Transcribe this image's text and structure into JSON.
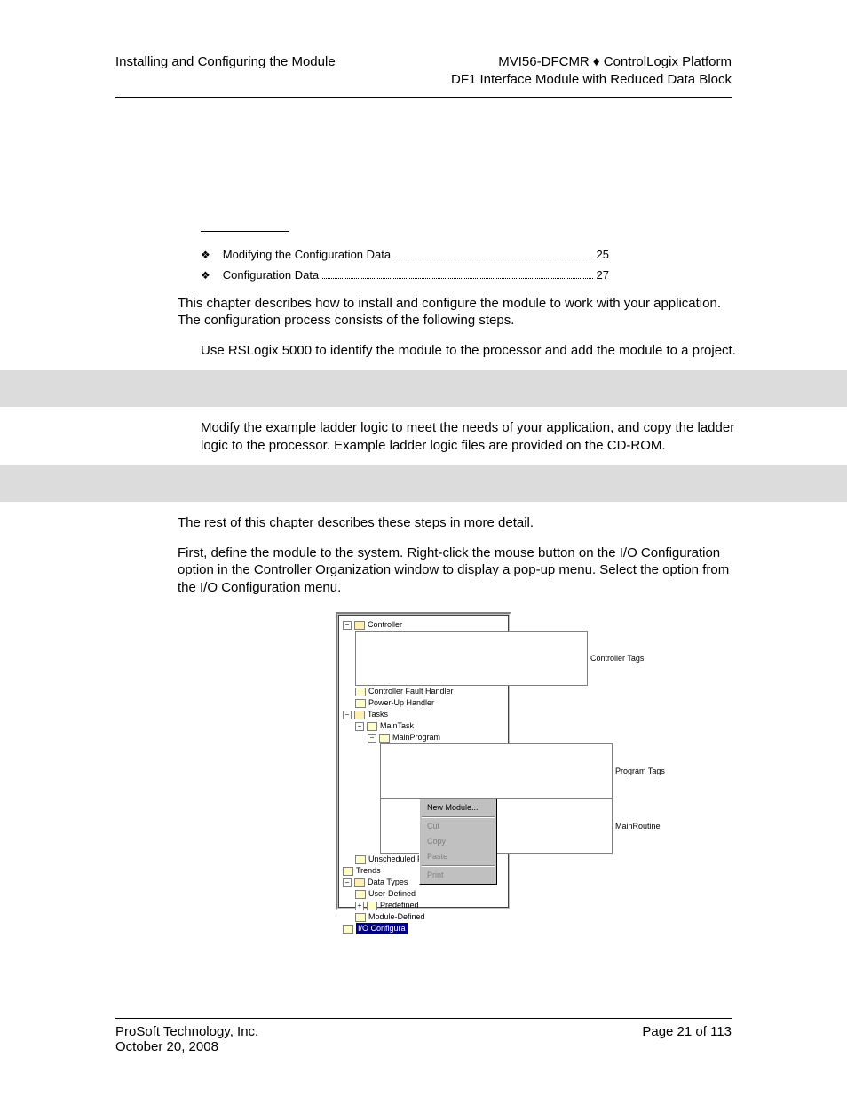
{
  "header": {
    "left": "Installing and Configuring the Module",
    "right_line1": "MVI56-DFCMR ♦ ControlLogix Platform",
    "right_line2": "DF1 Interface Module with Reduced Data Block"
  },
  "toc": [
    {
      "bullet": "❖",
      "title": "Modifying the Configuration Data",
      "page": "25"
    },
    {
      "bullet": "❖",
      "title": "Configuration Data",
      "page": "27"
    }
  ],
  "para_intro": "This chapter describes how to install and configure the module to work with your application. The configuration process consists of the following steps.",
  "step1": "Use RSLogix 5000 to identify the module to the processor and add the module to a project.",
  "step2": "Modify the example ladder logic to meet the needs of your application, and copy the ladder logic to the processor. Example ladder logic files are provided on the CD-ROM.",
  "para_rest": "The rest of this chapter describes these steps in more detail.",
  "para_define_a": "First, define the module to the system. Right-click the mouse button on the I/O Configuration option in the Controller Organization window to display a pop-up menu. Select the ",
  "para_define_b": " option from the I/O Configuration menu.",
  "tree": {
    "controller": "Controller",
    "controller_tags": "Controller Tags",
    "fault_handler": "Controller Fault Handler",
    "powerup": "Power-Up Handler",
    "tasks": "Tasks",
    "maintask": "MainTask",
    "mainprogram": "MainProgram",
    "program_tags": "Program Tags",
    "mainroutine": "MainRoutine",
    "unscheduled": "Unscheduled Programs",
    "trends": "Trends",
    "datatypes": "Data Types",
    "userdef": "User-Defined",
    "predef": "Predefined",
    "moddef": "Module-Defined",
    "ioconfig": "I/O Configura"
  },
  "context_menu": {
    "new_module": "New Module...",
    "cut": "Cut",
    "copy": "Copy",
    "paste": "Paste",
    "print": "Print"
  },
  "footer": {
    "company": "ProSoft Technology, Inc.",
    "date": "October 20, 2008",
    "page": "Page 21 of 113"
  }
}
